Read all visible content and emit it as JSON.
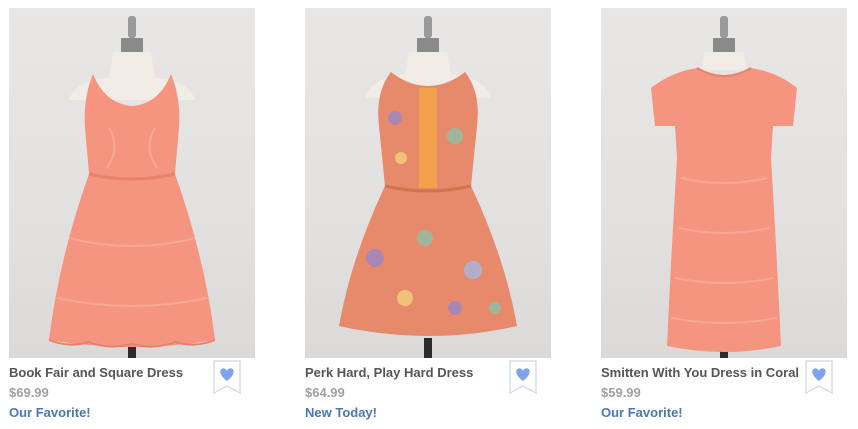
{
  "products": [
    {
      "name": "Book Fair and Square Dress",
      "price": "$69.99",
      "tag": "Our Favorite!",
      "image": "coral-lace-sleeveless-dress-on-mannequin"
    },
    {
      "name": "Perk Hard, Play Hard Dress",
      "price": "$64.99",
      "tag": "New Today!",
      "image": "orange-floral-print-dress-on-mannequin"
    },
    {
      "name": "Smitten With You Dress in Coral",
      "price": "$59.99",
      "tag": "Our Favorite!",
      "image": "coral-knit-short-sleeve-dress-on-mannequin"
    }
  ],
  "colors": {
    "tag": "#4a78b5",
    "name": "#555555",
    "price": "#a0a0a0",
    "heart": "#7fa3e8",
    "coral": "#f59580",
    "floral": "#e78a6c"
  },
  "icons": {
    "favorite": "heart-bookmark-icon"
  }
}
